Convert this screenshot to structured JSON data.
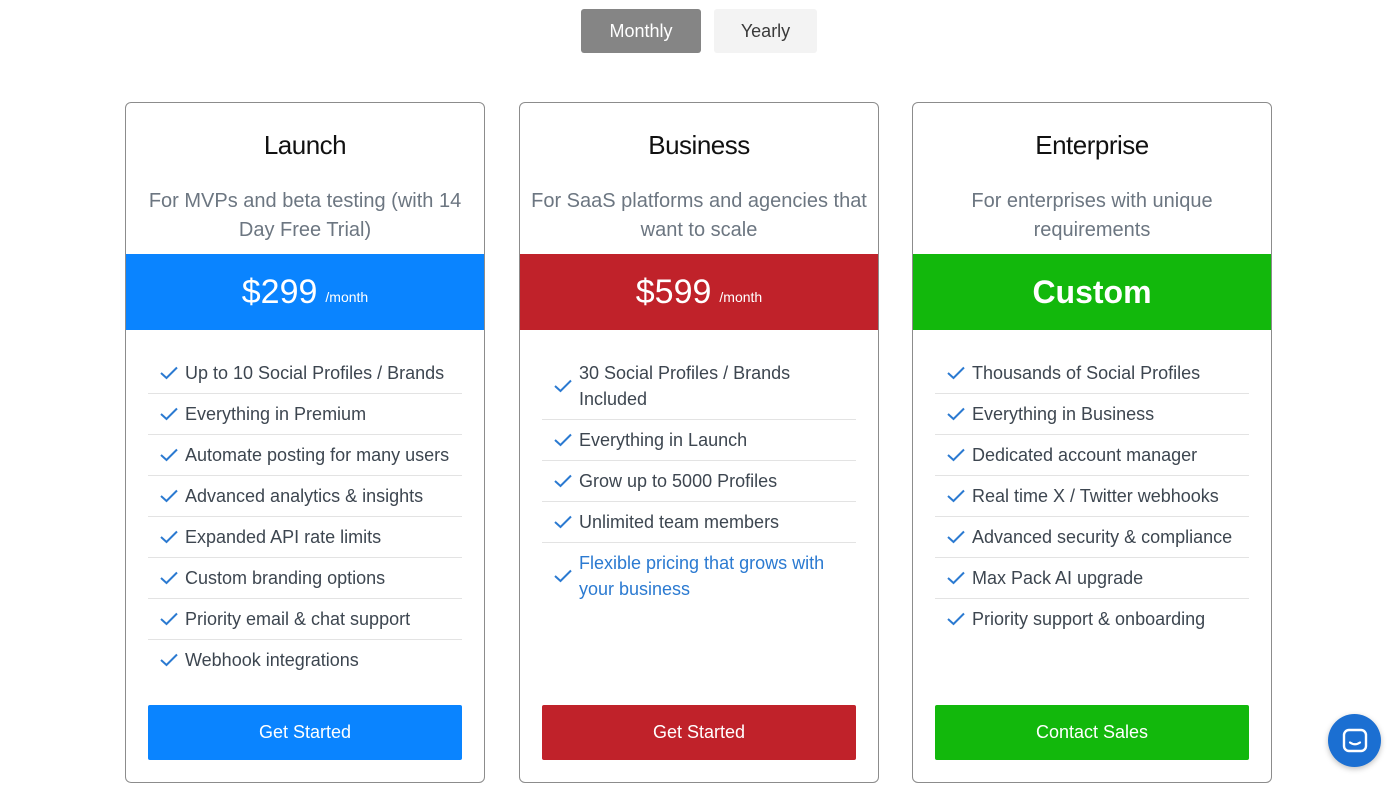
{
  "billing_toggle": {
    "monthly_label": "Monthly",
    "yearly_label": "Yearly",
    "selected": "Monthly"
  },
  "plans": [
    {
      "name": "Launch",
      "description": "For MVPs and beta testing (with 14 Day Free Trial)",
      "price": "$299",
      "period": "/month",
      "accent_color": "#0a84ff",
      "features": [
        "Up to 10 Social Profiles / Brands",
        "Everything in Premium",
        "Automate posting for many users",
        "Advanced analytics & insights",
        "Expanded API rate limits",
        "Custom branding options",
        "Priority email & chat support",
        "Webhook integrations"
      ],
      "cta_label": "Get Started"
    },
    {
      "name": "Business",
      "description": "For SaaS platforms and agencies that want to scale",
      "price": "$599",
      "period": "/month",
      "accent_color": "#c0222a",
      "features": [
        "30 Social Profiles / Brands Included",
        "Everything in Launch",
        "Grow up to 5000 Profiles",
        "Unlimited team members",
        "Flexible pricing that grows with your business"
      ],
      "cta_label": "Get Started"
    },
    {
      "name": "Enterprise",
      "description": "For enterprises with unique requirements",
      "price": "Custom",
      "accent_color": "#12b80c",
      "features": [
        "Thousands of Social Profiles",
        "Everything in Business",
        "Dedicated account manager",
        "Real time X / Twitter webhooks",
        "Advanced security & compliance",
        "Max Pack AI upgrade",
        "Priority support & onboarding"
      ],
      "cta_label": "Contact Sales"
    }
  ],
  "icons": {
    "feature_check": "check-icon",
    "chat_launcher": "chat-icon"
  }
}
